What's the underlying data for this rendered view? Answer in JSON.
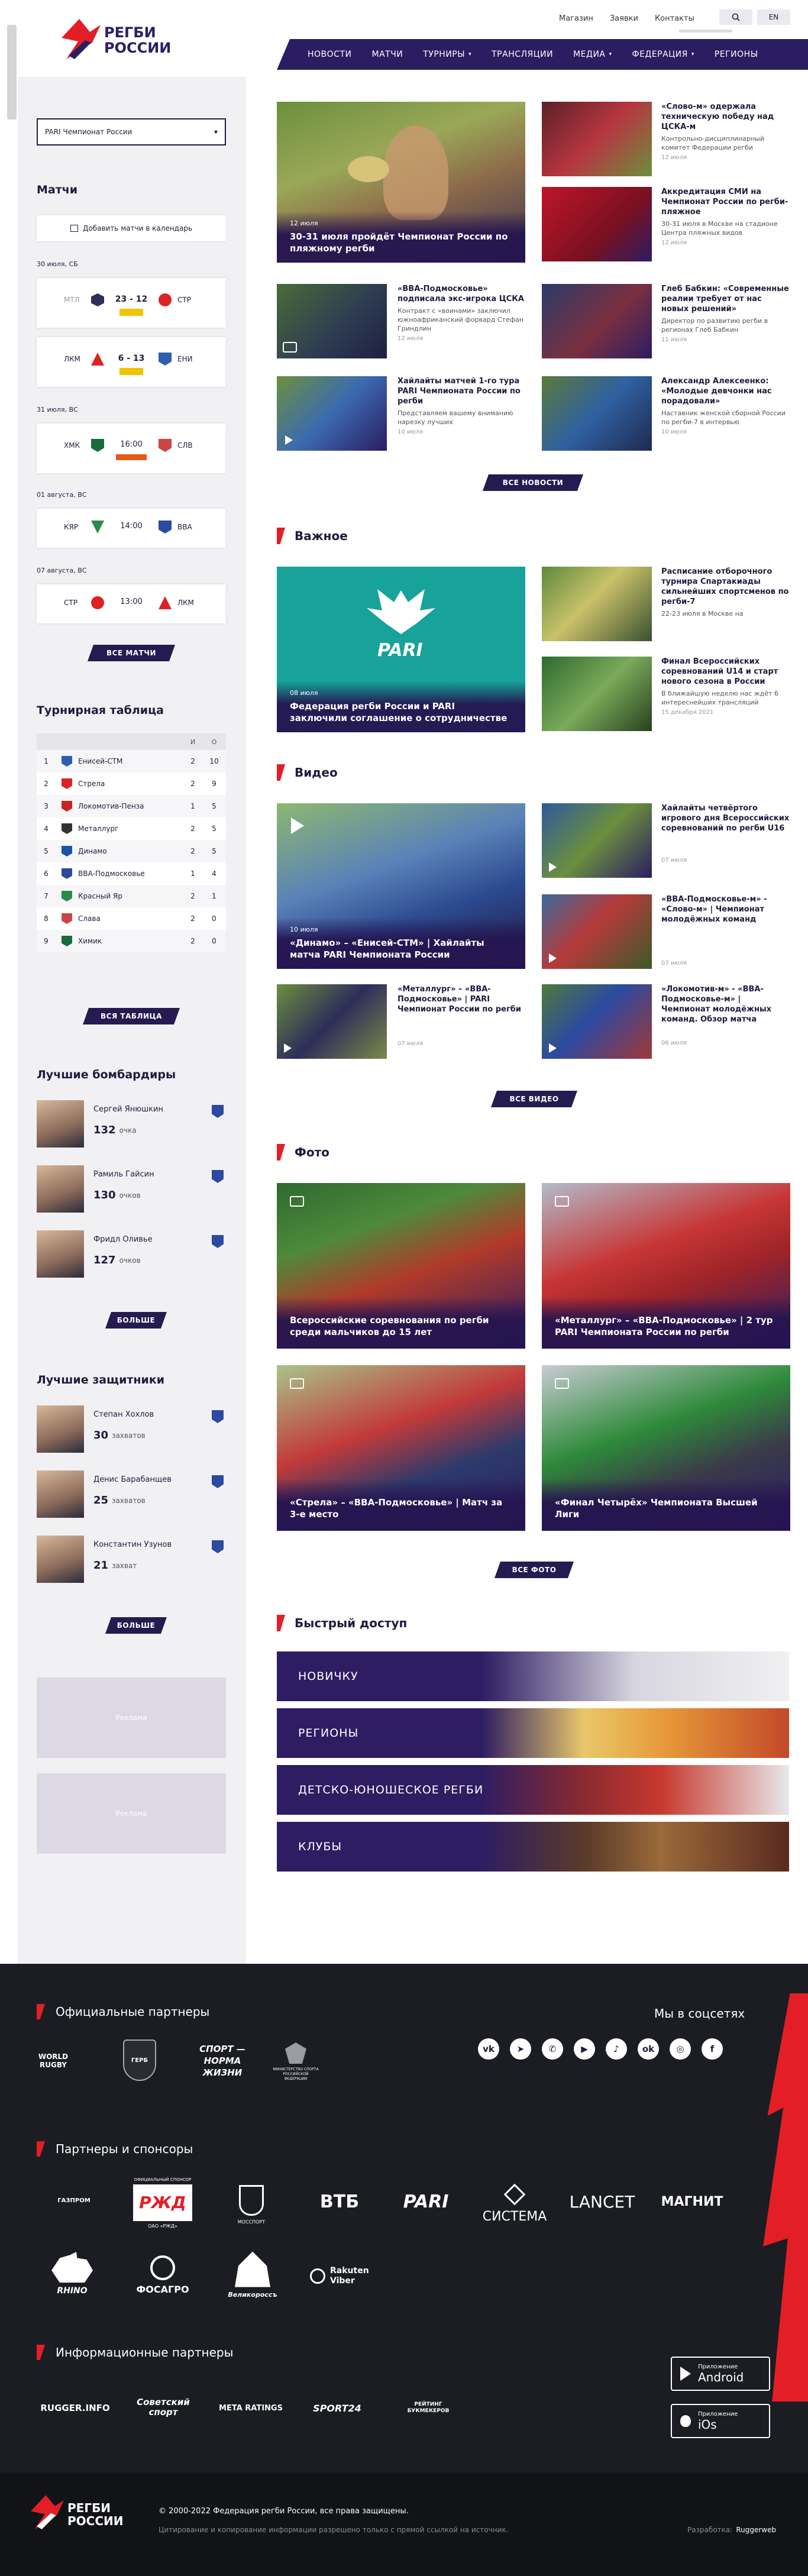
{
  "header": {
    "logo_line1": "РЕГБИ",
    "logo_line2": "РОССИИ",
    "top_links": [
      "Магазин",
      "Заявки",
      "Контакты"
    ],
    "lang": "EN",
    "nav": [
      "НОВОСТИ",
      "МАТЧИ",
      "ТУРНИРЫ",
      "ТРАНСЛЯЦИИ",
      "МЕДИА",
      "ФЕДЕРАЦИЯ",
      "РЕГИОНЫ"
    ]
  },
  "sidebar": {
    "championship_select": "PARI Чемпионат России",
    "matches_title": "Матчи",
    "add_calendar": "Добавить матчи в календарь",
    "match_days": [
      {
        "date": "30 июля, СБ",
        "matches": [
          {
            "home": "МТЛ",
            "score": "23 - 12",
            "away": "СТР",
            "tv": true,
            "score_mode": true
          },
          {
            "home": "ЛКМ",
            "score": "6 - 13",
            "away": "ЕНИ",
            "tv": true,
            "score_mode": true
          }
        ]
      },
      {
        "date": "31 июля, ВС",
        "matches": [
          {
            "home": "ХМК",
            "score": "16:00",
            "away": "СЛВ",
            "tv": true,
            "score_mode": false
          }
        ]
      },
      {
        "date": "01 августа, ВС",
        "matches": [
          {
            "home": "КЯР",
            "score": "14:00",
            "away": "ВВА",
            "tv": false,
            "score_mode": false
          }
        ]
      },
      {
        "date": "07 августа, ВС",
        "matches": [
          {
            "home": "СТР",
            "score": "13:00",
            "away": "ЛКМ",
            "tv": false,
            "score_mode": false
          }
        ]
      }
    ],
    "all_matches": "ВСЕ МАТЧИ",
    "table_title": "Турнирная таблица",
    "table_cols": [
      "И",
      "О"
    ],
    "table_rows": [
      {
        "pos": "1",
        "team": "Енисей-СТМ",
        "g": "2",
        "p": "10",
        "color": "#2b5fb0"
      },
      {
        "pos": "2",
        "team": "Стрела",
        "g": "2",
        "p": "9",
        "color": "#d22"
      },
      {
        "pos": "3",
        "team": "Локомотив-Пенза",
        "g": "1",
        "p": "5",
        "color": "#c22"
      },
      {
        "pos": "4",
        "team": "Металлург",
        "g": "2",
        "p": "5",
        "color": "#333"
      },
      {
        "pos": "5",
        "team": "Динамо",
        "g": "2",
        "p": "5",
        "color": "#1a55a5"
      },
      {
        "pos": "6",
        "team": "ВВА-Подмосковье",
        "g": "1",
        "p": "4",
        "color": "#2b4aa0"
      },
      {
        "pos": "7",
        "team": "Красный Яр",
        "g": "2",
        "p": "1",
        "color": "#2a8a4a"
      },
      {
        "pos": "8",
        "team": "Слава",
        "g": "2",
        "p": "0",
        "color": "#c44"
      },
      {
        "pos": "9",
        "team": "Химик",
        "g": "2",
        "p": "0",
        "color": "#1a6b3a"
      }
    ],
    "all_table": "ВСЯ ТАБЛИЦА",
    "scorers_title": "Лучшие бомбардиры",
    "scorers": [
      {
        "name": "Сергей Янюшкин",
        "value": "132",
        "unit": "очка"
      },
      {
        "name": "Рамиль Гайсин",
        "value": "130",
        "unit": "очков"
      },
      {
        "name": "Фридл Оливье",
        "value": "127",
        "unit": "очков"
      }
    ],
    "more1": "БОЛЬШЕ",
    "defenders_title": "Лучшие защитники",
    "defenders": [
      {
        "name": "Степан Хохлов",
        "value": "30",
        "unit": "захватов"
      },
      {
        "name": "Денис Барабанщев",
        "value": "25",
        "unit": "захватов"
      },
      {
        "name": "Константин Узунов",
        "value": "21",
        "unit": "захват"
      }
    ],
    "more2": "БОЛЬШЕ",
    "ad": "Реклама"
  },
  "news": {
    "main": {
      "date": "12 июля",
      "title": "30-31 июля пройдёт Чемпионат России по пляжному регби"
    },
    "right": [
      {
        "title": "«Слово-м» одержала техническую победу над ЦСКА-м",
        "desc": "Контрольно-дисциплинарный комитет Федерации регби",
        "date": "12 июля"
      },
      {
        "title": "Аккредитация СМИ на Чемпионат России по регби-пляжное",
        "desc": "30-31 июля в Москве на стадионе Центра пляжных видов",
        "date": "12 июля"
      }
    ],
    "row2": [
      {
        "title": "«ВВА-Подмосковье» подписала экс-игрока ЦСКА",
        "desc": "Контракт с «воинами» заключил южноафриканский форвард Стефан Гриндлин",
        "date": "12 июля"
      },
      {
        "title": "Глеб Бабкин: «Современные реалии требует от нас новых решений»",
        "desc": "Директор по развитию регби в регионах Глеб Бабкин",
        "date": "11 июля"
      }
    ],
    "row3": [
      {
        "title": "Хайлайты матчей 1-го тура PARI Чемпионата России по регби",
        "desc": "Представляем вашему вниманию нарезку лучших",
        "date": "10 июля"
      },
      {
        "title": "Александр Алексеенко: «Молодые девчонки нас порадовали»",
        "desc": "Наставник женской сборной России по регби-7 в интервью",
        "date": "10 июля"
      }
    ],
    "all": "ВСЕ НОВОСТИ"
  },
  "important": {
    "title": "Важное",
    "main": {
      "date": "08 июля",
      "title": "Федерация регби России и PARI заключили соглашение о сотрудничестве",
      "logo": "PARI"
    },
    "items": [
      {
        "title": "Расписание отборочного турнира Спартакиады сильнейших спортсменов по регби-7",
        "desc": "22-23 июля в Москве на",
        "date": ""
      },
      {
        "title": "Финал Всероссийских соревнований U14 и старт нового сезона в России",
        "desc": "В ближайшую неделю нас ждёт 6 интереснейших трансляций",
        "date": "15 декабря 2021"
      }
    ]
  },
  "video": {
    "title": "Видео",
    "main": {
      "date": "10 июля",
      "title": "«Динамо» – «Енисей-СТМ» | Хайлайты матча PARI Чемпионата России"
    },
    "items": [
      {
        "title": "Хайлайты четвёртого игрового дня Всероссийских соревнований по регби U16",
        "date": "07 июля"
      },
      {
        "title": "«ВВА-Подмосковье-м» - «Слово-м» | Чемпионат молодёжных команд",
        "date": "07 июля"
      },
      {
        "title": "«Металлург» – «ВВА-Подмосковье» | PARI Чемпионат России по регби",
        "date": "07 июля"
      },
      {
        "title": "«Локомотив-м» - «ВВА-Подмосковье-м» | Чемпионат молодёжных команд. Обзор матча",
        "date": "06 июля"
      }
    ],
    "all": "ВСЕ ВИДЕО"
  },
  "photo": {
    "title": "Фото",
    "items": [
      {
        "title": "Всероссийские соревнования по регби среди мальчиков до 15 лет"
      },
      {
        "title": "«Металлург» – «ВВА-Подмосковье» | 2 тур PARI Чемпионата России по регби"
      },
      {
        "title": "«Стрела» – «ВВА-Подмосковье» | Матч за 3-е место"
      },
      {
        "title": "«Финал Четырёх» Чемпионата Высшей Лиги"
      }
    ],
    "all": "ВСЕ ФОТО"
  },
  "quick": {
    "title": "Быстрый доступ",
    "items": [
      "НОВИЧКУ",
      "РЕГИОНЫ",
      "ДЕТСКО-ЮНОШЕСКОЕ РЕГБИ",
      "КЛУБЫ"
    ]
  },
  "footer": {
    "official_title": "Официальные партнеры",
    "social_title": "Мы в соцсетях",
    "official": [
      "WORLD RUGBY",
      "ГЕРБ",
      "СПОРТ — НОРМА ЖИЗНИ",
      "МИНСПОРТ РОССИИ"
    ],
    "official_sub": "МИНИСТЕРСТВО СПОРТА РОССИЙСКОЙ ФЕДЕРАЦИИ",
    "sponsors_title": "Партнеры и спонсоры",
    "sponsors": [
      "ГАЗПРОМ",
      "РЖД",
      "МОССПОРТ",
      "ВТБ",
      "PARI",
      "СИСТЕМА",
      "LANCET",
      "МАГНИТ",
      "RHINO",
      "ФОСАГРО",
      "Великороссъ",
      "Rakuten Viber"
    ],
    "rzd_sub": "ОАО «РЖД»",
    "rzd_top": "ОФИЦИАЛЬНЫЙ СПОНСОР",
    "info_title": "Информационные партнеры",
    "info": [
      "RUGGER.INFO",
      "Советский спорт",
      "META RATINGS",
      "SPORT24",
      "РЕЙТИНГ БУКМЕКЕРОВ"
    ],
    "app1_small": "Приложение",
    "app1": "Android",
    "app2_small": "Приложение",
    "app2": "iOs",
    "copyright": "© 2000-2022  Федерация регби России, все права защищены.",
    "note": "Цитирование и копирование информации разрешено только с прямой ссылкой на источник.",
    "dev_label": "Разработка:",
    "dev": "Ruggerweb"
  }
}
